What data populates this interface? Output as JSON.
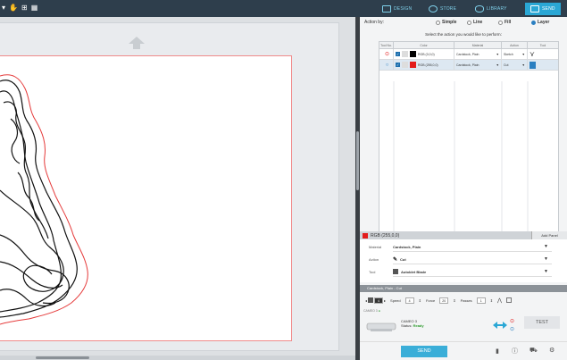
{
  "topbar": {
    "tabs": [
      {
        "label": "DESIGN",
        "icon": "design-icon"
      },
      {
        "label": "STORE",
        "icon": "store-icon"
      },
      {
        "label": "LIBRARY",
        "icon": "library-icon"
      },
      {
        "label": "SEND",
        "icon": "send-icon",
        "active": true
      }
    ]
  },
  "send_panel": {
    "action_by_label": "Action by:",
    "options": [
      {
        "label": "Simple",
        "selected": false
      },
      {
        "label": "Line",
        "selected": false
      },
      {
        "label": "Fill",
        "selected": false
      },
      {
        "label": "Layer",
        "selected": true
      }
    ],
    "instruction": "Select the action you would like to perform:",
    "table": {
      "columns": [
        "Tool No.",
        "Color",
        "Material",
        "Action",
        "Tool"
      ],
      "rows": [
        {
          "color_label": "RGB (0,0,0)",
          "color_hex": "#000000",
          "material": "Cardstock, Plain",
          "action": "Sketch",
          "tool_icon": "pen-icon"
        },
        {
          "color_label": "RGB (255,0,0)",
          "color_hex": "#e31b1b",
          "material": "Cardstock, Plain",
          "action": "Cut",
          "tool_icon": "blade-icon"
        }
      ]
    },
    "selected_color_label": "RGB (255,0,0)",
    "add_panel_label": "Add Panel",
    "properties": {
      "material_label": "Material",
      "material_value": "Cardstock, Plain",
      "action_label": "Action",
      "action_value": "Cut",
      "tool_label": "Tool",
      "tool_value": "Autoblet Blade"
    },
    "preset_bar": "Cardstock, Plain - Cut",
    "controls": {
      "blade_value": "4",
      "speed_label": "Speed",
      "speed_value": "4",
      "force_label": "Force",
      "force_value": "20",
      "passes_label": "Passes",
      "passes_value": "1"
    },
    "machine_header": "CAMEO 3",
    "machine": {
      "name": "CAMEO 3",
      "status_label": "Status:",
      "status_value": "Ready"
    },
    "send_label": "SEND",
    "test_label": "TEST"
  },
  "colors": {
    "accent": "#3aaed8",
    "topbar_bg": "#2e3e4c",
    "mat_border": "#f08a8a",
    "status_ready": "#2f9c2f"
  }
}
